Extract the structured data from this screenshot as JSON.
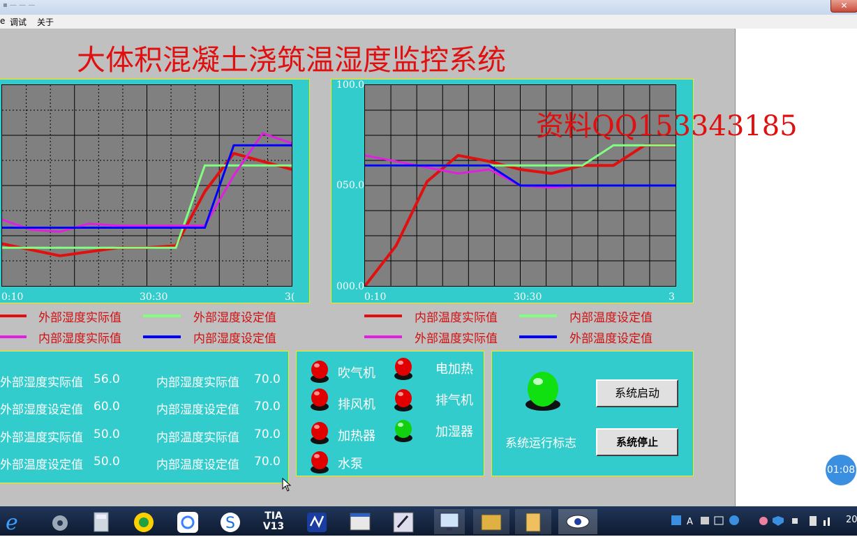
{
  "menubar": {
    "items": [
      "调试",
      "关于"
    ],
    "left_fragment": "e"
  },
  "hmi": {
    "title": "大体积混凝土浇筑温湿度监控系统",
    "watermark": "资料QQ153343185",
    "colors": {
      "panel": "#33cccc",
      "plot_bg": "#808080",
      "red": "#e01010",
      "green": "#80ff80",
      "blue": "#0000ff",
      "magenta": "#e020e0"
    }
  },
  "chart_left": {
    "x_ticks": [
      "0:10",
      "30:30",
      "3("
    ],
    "legend": [
      {
        "label": "外部湿度实际值",
        "color": "#e01010"
      },
      {
        "label": "外部湿度设定值",
        "color": "#80ff80"
      },
      {
        "label": "内部湿度实际值",
        "color": "#e020e0"
      },
      {
        "label": "内部湿度设定值",
        "color": "#0000ff"
      }
    ]
  },
  "chart_right": {
    "y_ticks": [
      "100.0",
      "050.0",
      "000.0"
    ],
    "x_ticks": [
      "0:10",
      "30:30",
      "3"
    ],
    "legend": [
      {
        "label": "内部温度实际值",
        "color": "#e01010"
      },
      {
        "label": "内部温度设定值",
        "color": "#80ff80"
      },
      {
        "label": "外部温度实际值",
        "color": "#e020e0"
      },
      {
        "label": "外部温度设定值",
        "color": "#0000ff"
      }
    ]
  },
  "chart_data": [
    {
      "type": "line",
      "ylim": [
        0,
        100
      ],
      "x": [
        0,
        10,
        20,
        30,
        40,
        50,
        60,
        70,
        80,
        90,
        100
      ],
      "series": [
        {
          "name": "外部湿度实际值",
          "values": [
            21,
            18,
            15,
            17,
            19,
            19,
            20,
            47,
            66,
            62,
            58
          ]
        },
        {
          "name": "外部湿度设定值",
          "values": [
            19,
            19,
            19,
            19,
            19,
            19,
            19,
            60,
            60,
            60,
            60
          ]
        },
        {
          "name": "内部湿度实际值",
          "values": [
            33,
            28,
            27,
            31,
            30,
            30,
            30,
            30,
            55,
            76,
            71
          ]
        },
        {
          "name": "内部湿度设定值",
          "values": [
            29,
            29,
            29,
            29,
            29,
            29,
            29,
            29,
            70,
            70,
            70
          ]
        }
      ]
    },
    {
      "type": "line",
      "ylim": [
        0,
        100
      ],
      "y_ticks": [
        "100.0",
        "050.0",
        "000.0"
      ],
      "x": [
        0,
        10,
        20,
        30,
        40,
        50,
        60,
        70,
        80,
        90,
        100
      ],
      "series": [
        {
          "name": "内部温度实际值",
          "values": [
            0,
            20,
            52,
            65,
            62,
            58,
            56,
            60,
            60,
            70,
            70
          ]
        },
        {
          "name": "内部温度设定值",
          "values": [
            60,
            60,
            60,
            60,
            60,
            60,
            60,
            60,
            70,
            70,
            70
          ]
        },
        {
          "name": "外部温度实际值",
          "values": [
            65,
            62,
            59,
            56,
            58,
            50,
            49,
            50,
            50,
            50,
            50
          ]
        },
        {
          "name": "外部温度设定值",
          "values": [
            60,
            60,
            60,
            60,
            60,
            50,
            50,
            50,
            50,
            50,
            50
          ]
        }
      ]
    }
  ],
  "values_panel": {
    "left": [
      {
        "label": "外部湿度实际值",
        "value": "56.0"
      },
      {
        "label": "外部湿度设定值",
        "value": "60.0"
      },
      {
        "label": "外部温度实际值",
        "value": "50.0"
      },
      {
        "label": "外部温度设定值",
        "value": "50.0"
      }
    ],
    "right": [
      {
        "label": "内部湿度实际值",
        "value": "70.0"
      },
      {
        "label": "内部湿度设定值",
        "value": "70.0"
      },
      {
        "label": "内部温度实际值",
        "value": "70.0"
      },
      {
        "label": "内部温度设定值",
        "value": "70.0"
      }
    ]
  },
  "indicators": [
    {
      "label": "吹气机",
      "state": "red"
    },
    {
      "label": "电加热",
      "state": "red"
    },
    {
      "label": "排风机",
      "state": "red"
    },
    {
      "label": "排气机",
      "state": "red"
    },
    {
      "label": "加热器",
      "state": "red"
    },
    {
      "label": "加湿器",
      "state": "green"
    },
    {
      "label": "水泵",
      "state": "red"
    }
  ],
  "system": {
    "start_label": "系统启动",
    "stop_label": "系统停止",
    "run_flag_label": "系统运行标志",
    "run_state": "green"
  },
  "clock": "01:08",
  "taskbar": {
    "tia_line1": "TIA",
    "tia_line2": "V13",
    "tray_text": "20"
  }
}
